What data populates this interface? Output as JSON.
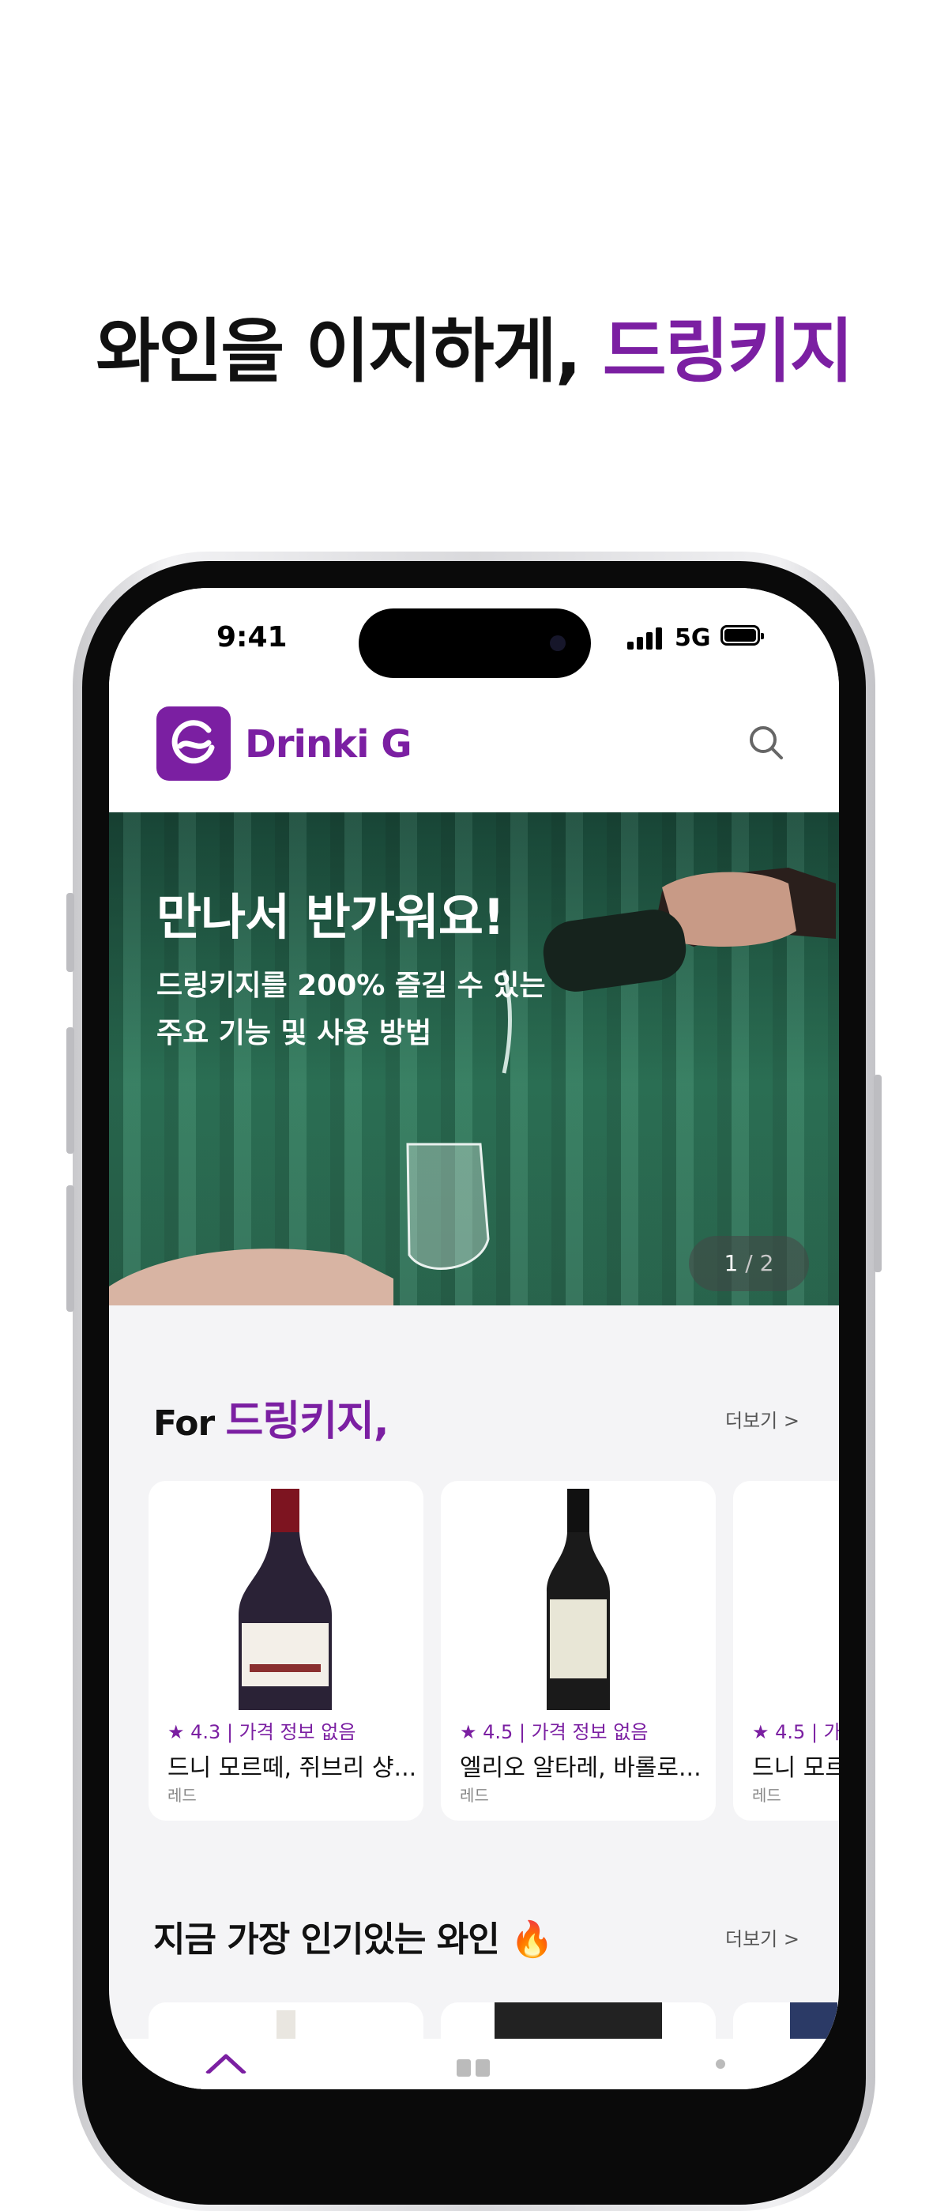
{
  "headline": {
    "prefix": "와인을 이지하게, ",
    "brand": "드링키지"
  },
  "status_bar": {
    "time": "9:41",
    "network": "5G"
  },
  "app_bar": {
    "logo_text": "Drinki G",
    "search_icon": "search-icon"
  },
  "banner": {
    "title": "만나서 반가워요!",
    "subtitle_line1": "드링키지를 200% 즐길 수 있는",
    "subtitle_line2": "주요 기능 및 사용 방법",
    "pager_current": "1",
    "pager_sep_total": " / 2"
  },
  "section_for_you": {
    "title_prefix": "For ",
    "title_accent": "드링키지,",
    "more_label": "더보기 >"
  },
  "wine_cards": [
    {
      "meta": "★ 4.3 | 가격 정보 없음",
      "name": "드니 모르떼, 쥐브리 샹...",
      "type": "레드"
    },
    {
      "meta": "★ 4.5 | 가격 정보 없음",
      "name": "엘리오 알타레, 바롤로...",
      "type": "레드"
    },
    {
      "meta": "★ 4.5 | 가",
      "name": "드니 모르",
      "type": "레드"
    }
  ],
  "section_popular": {
    "title": "지금 가장 인기있는 와인 🔥",
    "more_label": "더보기 >"
  },
  "colors": {
    "brand": "#7b1fa2",
    "text": "#111111",
    "background": "#f4f4f6"
  }
}
